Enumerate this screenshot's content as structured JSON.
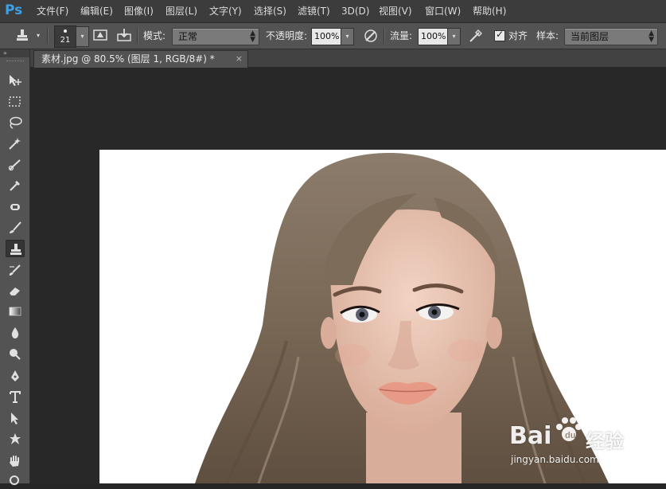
{
  "app": {
    "logo": "Ps"
  },
  "menu": [
    {
      "label": "文件(F)"
    },
    {
      "label": "编辑(E)"
    },
    {
      "label": "图像(I)"
    },
    {
      "label": "图层(L)"
    },
    {
      "label": "文字(Y)"
    },
    {
      "label": "选择(S)"
    },
    {
      "label": "滤镜(T)"
    },
    {
      "label": "3D(D)"
    },
    {
      "label": "视图(V)"
    },
    {
      "label": "窗口(W)"
    },
    {
      "label": "帮助(H)"
    }
  ],
  "options": {
    "brush_size": "21",
    "mode_label": "模式:",
    "mode_value": "正常",
    "opacity_label": "不透明度:",
    "opacity_value": "100%",
    "flow_label": "流量:",
    "flow_value": "100%",
    "aligned_label": "对齐",
    "aligned_checked": true,
    "sample_label": "样本:",
    "sample_value": "当前图层"
  },
  "toolbox": {
    "active_tool": "clone-stamp-tool",
    "tools": [
      "move-tool",
      "marquee-tool",
      "lasso-tool",
      "magic-wand-tool",
      "crop-tool",
      "eyedropper-tool",
      "spot-healing-tool",
      "brush-tool",
      "clone-stamp-tool",
      "history-brush-tool",
      "eraser-tool",
      "gradient-tool",
      "blur-tool",
      "dodge-tool",
      "pen-tool",
      "type-tool",
      "path-selection-tool",
      "shape-tool",
      "hand-tool",
      "zoom-tool"
    ]
  },
  "document": {
    "tab_title": "素材.jpg @ 80.5% (图层 1, RGB/8#) *",
    "close_glyph": "×"
  },
  "watermark": {
    "brand_a": "Bai",
    "brand_b": "经验",
    "url": "jingyan.baidu.com"
  },
  "colors": {
    "menubar_bg": "#3c3c3c",
    "panel_bg": "#535353",
    "workspace_bg": "#282828",
    "ps_blue": "#3d9fe6",
    "hair": "#7b6a59",
    "skin": "#e7c3b3"
  }
}
